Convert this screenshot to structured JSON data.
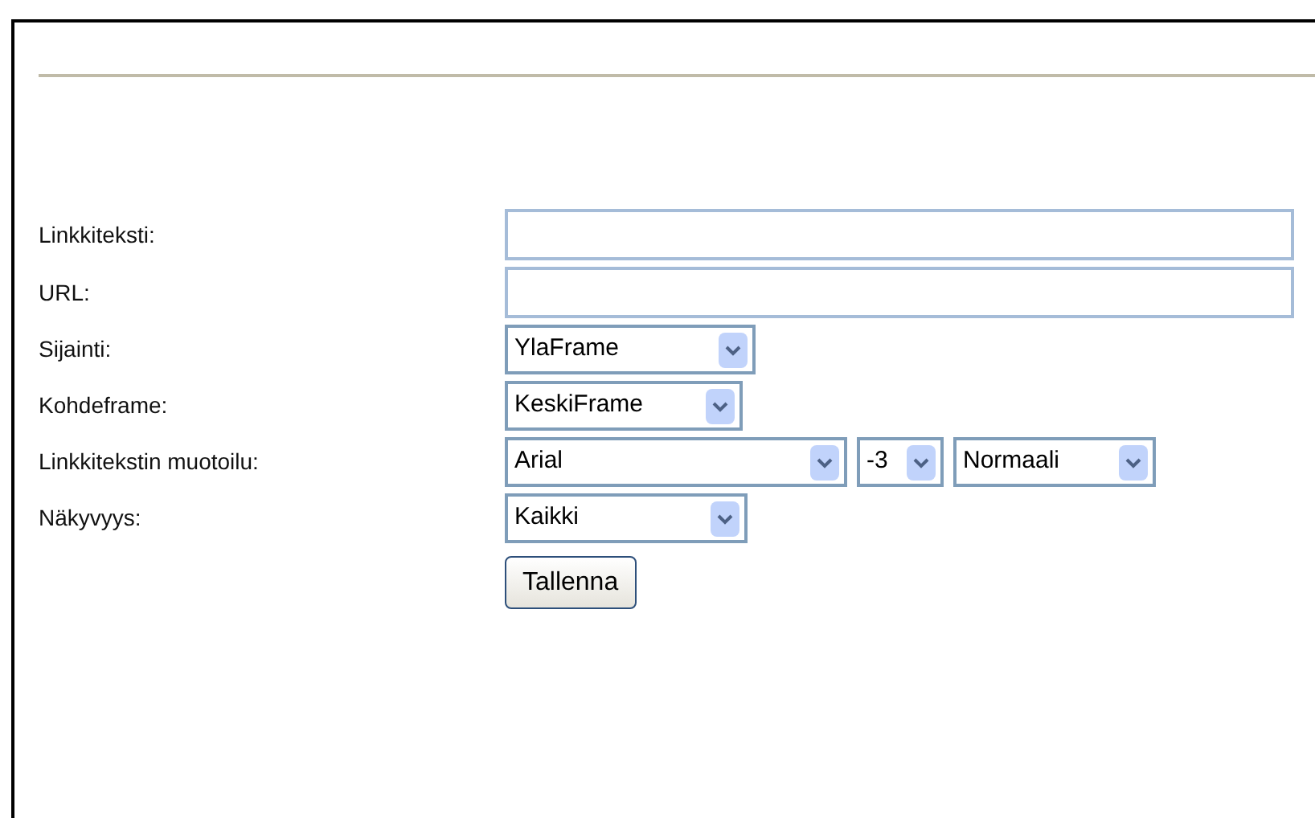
{
  "fields": [
    {
      "label": "Linkkiteksti:",
      "kind": "text"
    },
    {
      "label": "URL:",
      "kind": "text"
    },
    {
      "label": "Sijainti:",
      "kind": "select",
      "selects": [
        {
          "value": "YlaFrame"
        }
      ]
    },
    {
      "label": "Kohdeframe:",
      "kind": "select",
      "selects": [
        {
          "value": "KeskiFrame"
        }
      ]
    },
    {
      "label": "Linkkitekstin muotoilu:",
      "kind": "select",
      "selects": [
        {
          "value": "Arial"
        },
        {
          "value": "-3"
        },
        {
          "value": "Normaali"
        }
      ]
    },
    {
      "label": "Näkyvyys:",
      "kind": "select",
      "selects": [
        {
          "value": "Kaikki"
        }
      ]
    }
  ],
  "button": "Tallenna"
}
